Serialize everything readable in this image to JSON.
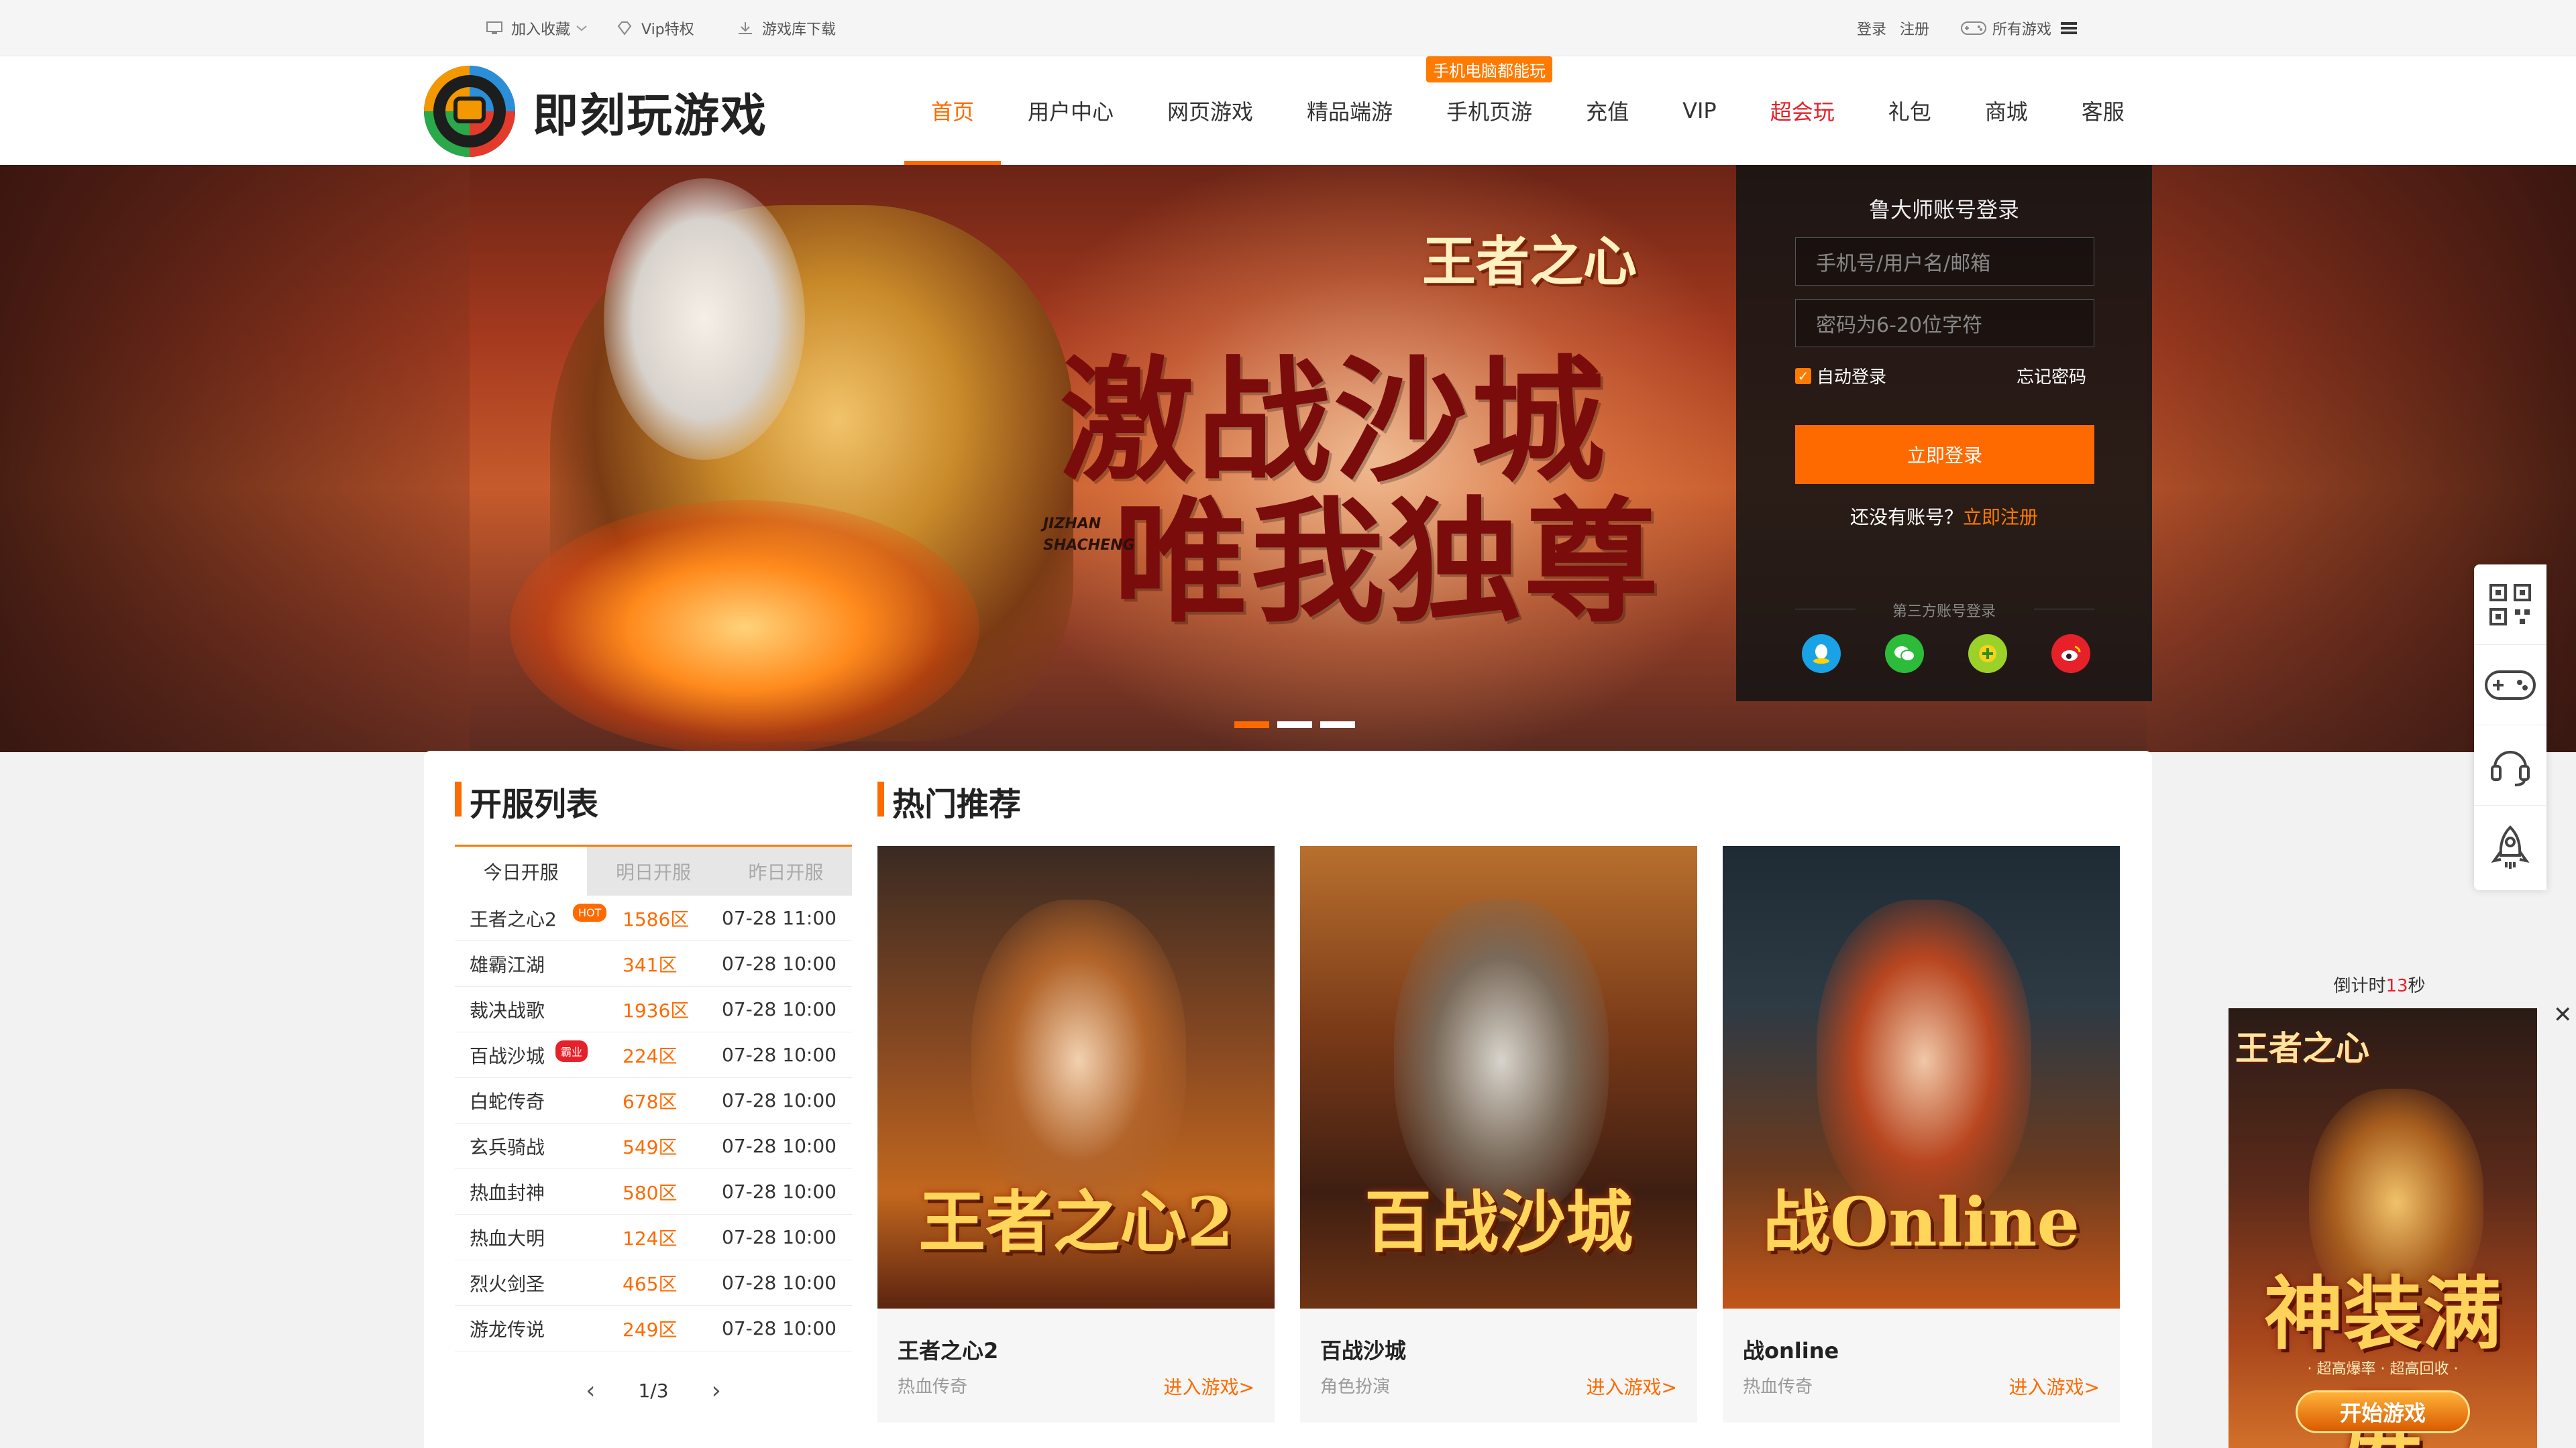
{
  "topbar": {
    "bookmark": "加入收藏",
    "vip": "Vip特权",
    "download": "游戏库下载",
    "login": "登录",
    "register": "注册",
    "all_games": "所有游戏"
  },
  "header": {
    "logo_text": "即刻玩游戏",
    "nav": [
      {
        "label": "首页"
      },
      {
        "label": "用户中心"
      },
      {
        "label": "网页游戏"
      },
      {
        "label": "精品端游"
      },
      {
        "label": "手机页游",
        "badge": "手机电脑都能玩"
      },
      {
        "label": "充值"
      },
      {
        "label": "VIP"
      },
      {
        "label": "超会玩"
      },
      {
        "label": "礼包"
      },
      {
        "label": "商城"
      },
      {
        "label": "客服"
      }
    ]
  },
  "banner": {
    "game_logo": "王者之心",
    "slogan_line1": "激战沙城",
    "slogan_line2": "唯我独尊",
    "pinyin1": "JIZHAN",
    "pinyin2": "SHACHENG"
  },
  "login": {
    "title": "鲁大师账号登录",
    "username_placeholder": "手机号/用户名/邮箱",
    "password_placeholder": "密码为6-20位字符",
    "auto_login": "自动登录",
    "forgot": "忘记密码",
    "submit": "立即登录",
    "no_account": "还没有账号？",
    "register_now": "立即注册",
    "third_party": "第三方账号登录"
  },
  "servers": {
    "title": "开服列表",
    "tabs": [
      "今日开服",
      "明日开服",
      "昨日开服"
    ],
    "rows": [
      {
        "name": "王者之心2",
        "zone": "1586区",
        "time": "07-28 11:00",
        "tag": "HOT"
      },
      {
        "name": "雄霸江湖",
        "zone": "341区",
        "time": "07-28 10:00",
        "tag": ""
      },
      {
        "name": "裁决战歌",
        "zone": "1936区",
        "time": "07-28 10:00",
        "tag": ""
      },
      {
        "name": "百战沙城",
        "zone": "224区",
        "time": "07-28 10:00",
        "tag": "霸业"
      },
      {
        "name": "白蛇传奇",
        "zone": "678区",
        "time": "07-28 10:00",
        "tag": ""
      },
      {
        "name": "玄兵骑战",
        "zone": "549区",
        "time": "07-28 10:00",
        "tag": ""
      },
      {
        "name": "热血封神",
        "zone": "580区",
        "time": "07-28 10:00",
        "tag": ""
      },
      {
        "name": "热血大明",
        "zone": "124区",
        "time": "07-28 10:00",
        "tag": ""
      },
      {
        "name": "烈火剑圣",
        "zone": "465区",
        "time": "07-28 10:00",
        "tag": ""
      },
      {
        "name": "游龙传说",
        "zone": "249区",
        "time": "07-28 10:00",
        "tag": ""
      }
    ],
    "page": "1/3"
  },
  "hot": {
    "title": "热门推荐",
    "cards": [
      {
        "name": "王者之心2",
        "type": "热血传奇",
        "link": "进入游戏>",
        "art_text": "王者之心2"
      },
      {
        "name": "百战沙城",
        "type": "角色扮演",
        "link": "进入游戏>",
        "art_text": "百战沙城"
      },
      {
        "name": "战online",
        "type": "热血传奇",
        "link": "进入游戏>",
        "art_text": "战Online"
      }
    ]
  },
  "ad": {
    "countdown_prefix": "倒计时",
    "countdown_value": "13",
    "countdown_suffix": "秒",
    "logo": "王者之心",
    "headline": "神装满屏",
    "sub": "· 超高爆率 · 超高回收 ·",
    "button": "开始游戏"
  },
  "colors": {
    "accent": "#ff6a00",
    "red": "#e6212a"
  }
}
